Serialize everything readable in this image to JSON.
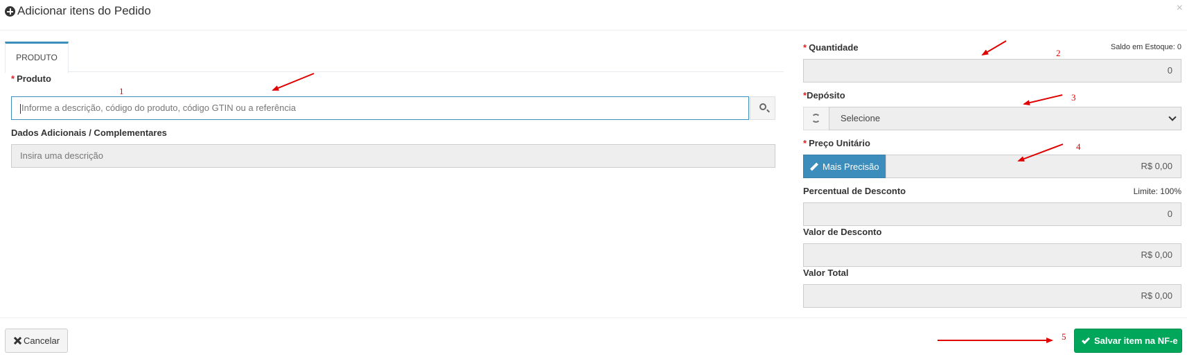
{
  "header": {
    "title": "Adicionar itens do Pedido",
    "close_label": "×"
  },
  "tabs": [
    {
      "label": "PRODUTO",
      "active": true
    }
  ],
  "left": {
    "produto": {
      "required_mark": "*",
      "label": "Produto",
      "placeholder": "Informe a descrição, código do produto, código GTIN ou a referência",
      "value": ""
    },
    "dados_adicionais": {
      "label": "Dados Adicionais / Complementares",
      "placeholder": "Insira uma descrição",
      "value": ""
    }
  },
  "right": {
    "quantidade": {
      "required_mark": "*",
      "label": "Quantidade",
      "stock_note": "Saldo em Estoque: 0",
      "value": "0"
    },
    "deposito": {
      "required_mark": "*",
      "label": "Depósito",
      "selected": "Selecione"
    },
    "preco_unitario": {
      "required_mark": "*",
      "label": "Preço Unitário",
      "button_label": "Mais Precisão",
      "value": "R$ 0,00"
    },
    "percentual_desconto": {
      "label": "Percentual de Desconto",
      "limit_note": "Limite: 100%",
      "value": "0"
    },
    "valor_desconto": {
      "label": "Valor de Desconto",
      "value": "R$ 0,00"
    },
    "valor_total": {
      "label": "Valor Total",
      "value": "R$ 0,00"
    }
  },
  "footer": {
    "cancel_label": "Cancelar",
    "save_label": "Salvar item na NF-e"
  },
  "annotations": {
    "numbers": [
      "1",
      "2",
      "3",
      "4",
      "5"
    ],
    "color": "#e00000"
  },
  "colors": {
    "primary": "#3c8dbc",
    "success": "#00a65a",
    "required": "#dd2222"
  }
}
